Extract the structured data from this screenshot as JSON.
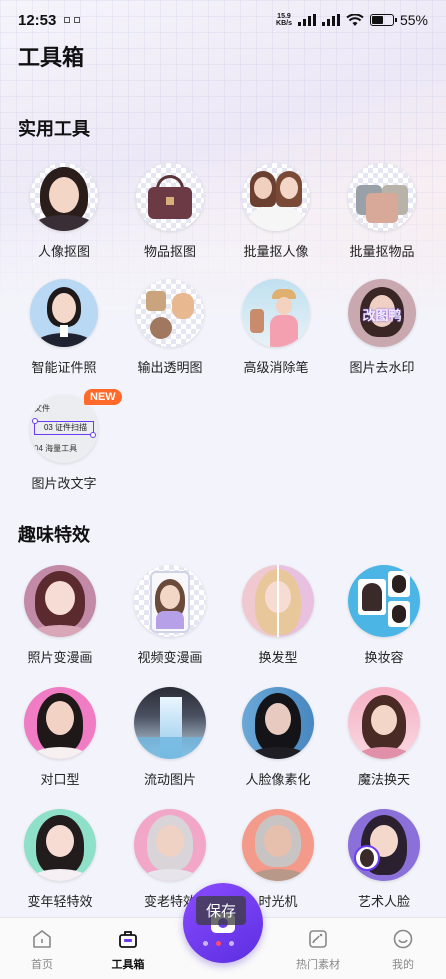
{
  "status_bar": {
    "time": "12:53",
    "net_speed_value": "15.9",
    "net_speed_unit": "KB/s",
    "battery_percent": "55%"
  },
  "header": {
    "title": "工具箱"
  },
  "sections": {
    "practical": {
      "title": "实用工具",
      "items": [
        {
          "label": "人像抠图",
          "icon": "portrait-cutout-thumb"
        },
        {
          "label": "物品抠图",
          "icon": "object-cutout-thumb"
        },
        {
          "label": "批量抠人像",
          "icon": "batch-portrait-thumb"
        },
        {
          "label": "批量抠物品",
          "icon": "batch-object-thumb"
        },
        {
          "label": "智能证件照",
          "icon": "id-photo-thumb"
        },
        {
          "label": "输出透明图",
          "icon": "transparent-output-thumb"
        },
        {
          "label": "高级消除笔",
          "icon": "eraser-pen-thumb"
        },
        {
          "label": "图片去水印",
          "icon": "watermark-remove-thumb",
          "overlay_text": "改图鸭"
        },
        {
          "label": "图片改文字",
          "icon": "edit-text-thumb",
          "badge": "NEW",
          "overlay_lines": [
            "文件",
            "03 证件扫描",
            "04 海量工具"
          ]
        }
      ]
    },
    "fun": {
      "title": "趣味特效",
      "items": [
        {
          "label": "照片变漫画",
          "icon": "photo-to-comic-thumb"
        },
        {
          "label": "视频变漫画",
          "icon": "video-to-comic-thumb"
        },
        {
          "label": "换发型",
          "icon": "hairstyle-thumb"
        },
        {
          "label": "换妆容",
          "icon": "makeup-thumb"
        },
        {
          "label": "对口型",
          "icon": "lip-sync-thumb"
        },
        {
          "label": "流动图片",
          "icon": "flow-image-thumb"
        },
        {
          "label": "人脸像素化",
          "icon": "face-pixelate-thumb"
        },
        {
          "label": "魔法换天",
          "icon": "sky-replace-thumb"
        },
        {
          "label": "变年轻特效",
          "icon": "younger-thumb"
        },
        {
          "label": "变老特效",
          "icon": "older-thumb"
        },
        {
          "label": "时光机",
          "icon": "time-machine-thumb"
        },
        {
          "label": "艺术人脸",
          "icon": "art-face-thumb"
        }
      ]
    }
  },
  "toast": {
    "text": "保存"
  },
  "bottom_nav": {
    "items": [
      {
        "label": "首页",
        "icon": "home-icon",
        "active": false
      },
      {
        "label": "工具箱",
        "icon": "toolbox-icon",
        "active": true
      },
      {
        "label": "热门素材",
        "icon": "materials-icon",
        "active": false
      },
      {
        "label": "我的",
        "icon": "profile-icon",
        "active": false
      }
    ]
  },
  "colors": {
    "accent": "#6a3bf0",
    "badge": "#ff6a2a"
  }
}
